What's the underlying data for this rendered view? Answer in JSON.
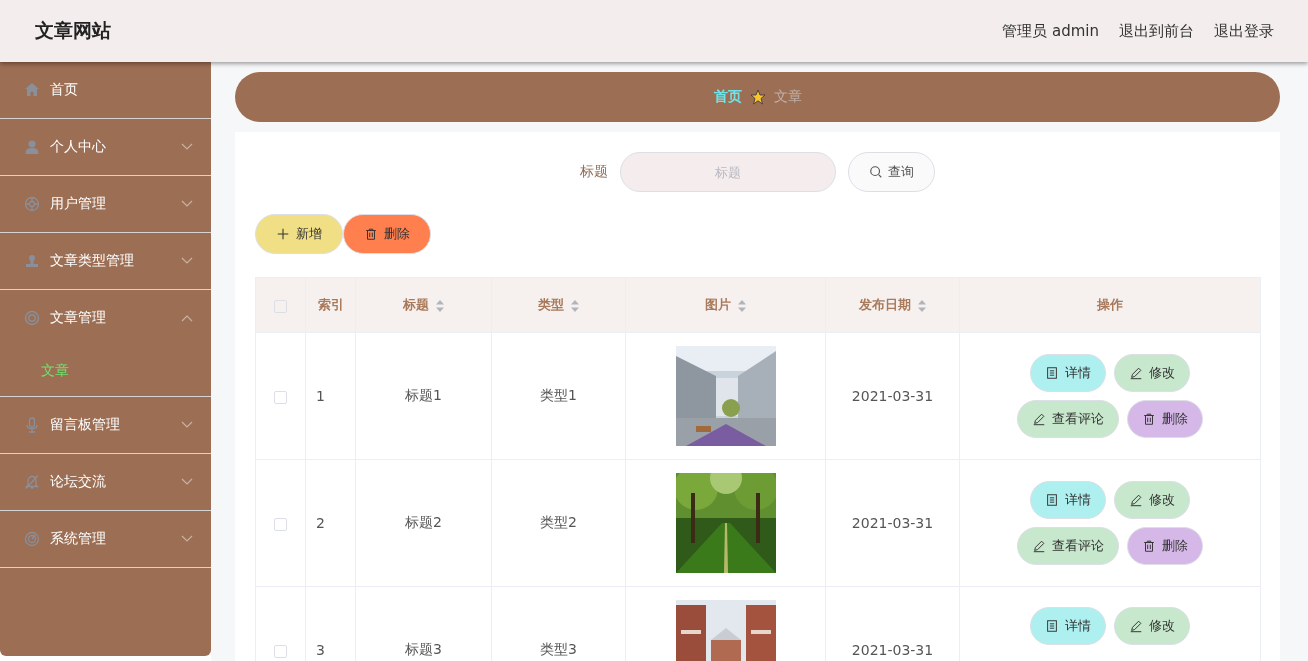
{
  "header": {
    "title": "文章网站",
    "links": [
      "管理员 admin",
      "退出到前台",
      "退出登录"
    ]
  },
  "sidebar": {
    "items": [
      {
        "label": "首页",
        "kind": "link"
      },
      {
        "label": "个人中心",
        "kind": "menu",
        "expanded": false
      },
      {
        "label": "用户管理",
        "kind": "menu",
        "expanded": false
      },
      {
        "label": "文章类型管理",
        "kind": "menu",
        "expanded": false
      },
      {
        "label": "文章管理",
        "kind": "menu",
        "expanded": true,
        "children": [
          {
            "label": "文章",
            "selected": true
          }
        ]
      },
      {
        "label": "留言板管理",
        "kind": "menu",
        "expanded": false
      },
      {
        "label": "论坛交流",
        "kind": "menu",
        "expanded": false
      },
      {
        "label": "系统管理",
        "kind": "menu",
        "expanded": false
      }
    ]
  },
  "breadcrumb": [
    {
      "label": "首页",
      "active": true
    },
    {
      "label": "文章",
      "active": false
    }
  ],
  "search": {
    "label": "标题",
    "placeholder": "标题",
    "button": "查询"
  },
  "actions": [
    {
      "label": "新增",
      "kind": "add"
    },
    {
      "label": "删除",
      "kind": "delete"
    }
  ],
  "table": {
    "select_all": {
      "checked": false
    },
    "columns": [
      {
        "label": "索引",
        "sortable": false
      },
      {
        "label": "标题",
        "sortable": true
      },
      {
        "label": "类型",
        "sortable": true
      },
      {
        "label": "图片",
        "sortable": true
      },
      {
        "label": "发布日期",
        "sortable": true
      },
      {
        "label": "操作",
        "sortable": false
      }
    ],
    "rows": [
      {
        "checked": false,
        "index": "1",
        "title": "标题1",
        "type": "类型1",
        "picture": {
          "kind": "picture"
        },
        "date": "2021-03-31",
        "actions": [
          {
            "label": "详情",
            "kind": "detail"
          },
          {
            "label": "修改",
            "kind": "edit"
          },
          {
            "label": "查看评论",
            "kind": "comment"
          },
          {
            "label": "删除",
            "kind": "delete"
          }
        ]
      },
      {
        "checked": false,
        "index": "2",
        "title": "标题2",
        "type": "类型2",
        "picture": {
          "kind": "picture"
        },
        "date": "2021-03-31",
        "actions": [
          {
            "label": "详情",
            "kind": "detail"
          },
          {
            "label": "修改",
            "kind": "edit"
          },
          {
            "label": "查看评论",
            "kind": "comment"
          },
          {
            "label": "删除",
            "kind": "delete"
          }
        ]
      },
      {
        "checked": false,
        "index": "3",
        "title": "标题3",
        "type": "类型3",
        "picture": {
          "kind": "picture"
        },
        "date": "2021-03-31",
        "actions": [
          {
            "label": "详情",
            "kind": "detail"
          },
          {
            "label": "修改",
            "kind": "edit"
          }
        ]
      }
    ]
  }
}
